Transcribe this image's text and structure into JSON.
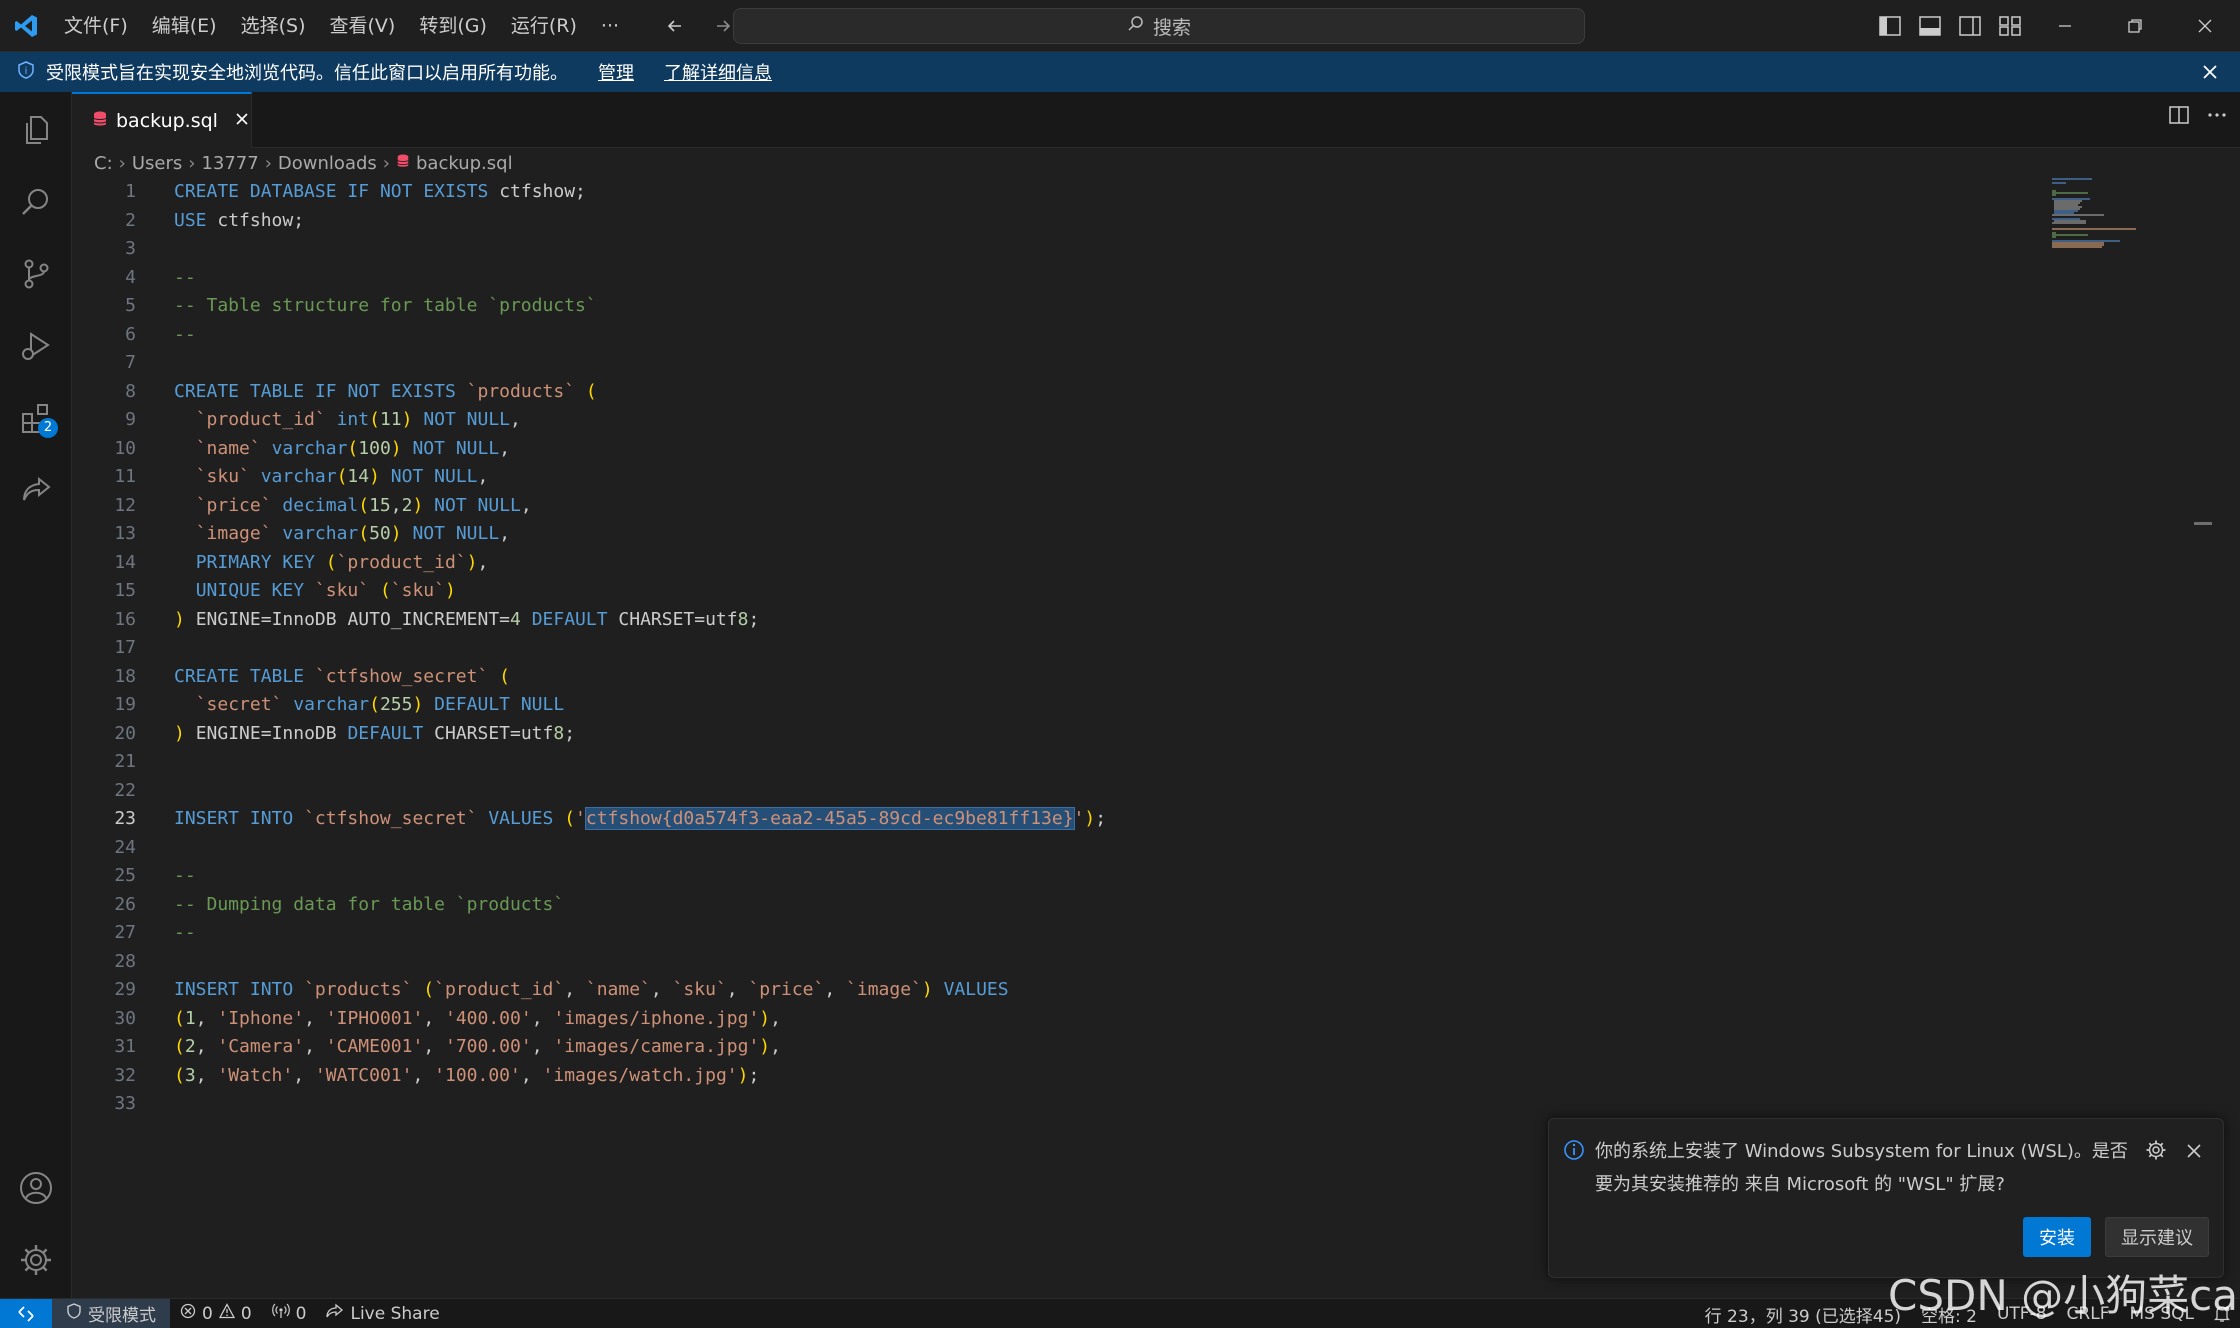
{
  "titlebar": {
    "menu": [
      "文件(F)",
      "编辑(E)",
      "选择(S)",
      "查看(V)",
      "转到(G)",
      "运行(R)",
      "···"
    ],
    "search_label": "搜索"
  },
  "banner": {
    "text": "受限模式旨在实现安全地浏览代码。信任此窗口以启用所有功能。",
    "manage": "管理",
    "learn_more": "了解详细信息"
  },
  "activity": {
    "extensions_badge": "2"
  },
  "tab": {
    "filename": "backup.sql"
  },
  "breadcrumb": [
    "C:",
    "Users",
    "13777",
    "Downloads",
    "backup.sql"
  ],
  "editor": {
    "active_line": 23,
    "lines": [
      "CREATE DATABASE IF NOT EXISTS ctfshow;",
      "USE ctfshow;",
      "",
      "--",
      "-- Table structure for table `products`",
      "--",
      "",
      "CREATE TABLE IF NOT EXISTS `products` (",
      "  `product_id` int(11) NOT NULL,",
      "  `name` varchar(100) NOT NULL,",
      "  `sku` varchar(14) NOT NULL,",
      "  `price` decimal(15,2) NOT NULL,",
      "  `image` varchar(50) NOT NULL,",
      "  PRIMARY KEY (`product_id`),",
      "  UNIQUE KEY `sku` (`sku`)",
      ") ENGINE=InnoDB AUTO_INCREMENT=4 DEFAULT CHARSET=utf8;",
      "",
      "CREATE TABLE `ctfshow_secret` (",
      "  `secret` varchar(255) DEFAULT NULL",
      ") ENGINE=InnoDB DEFAULT CHARSET=utf8;",
      "",
      "",
      "INSERT INTO `ctfshow_secret` VALUES ('ctfshow{d0a574f3-eaa2-45a5-89cd-ec9be81ff13e}');",
      "",
      "--",
      "-- Dumping data for table `products`",
      "--",
      "",
      "INSERT INTO `products` (`product_id`, `name`, `sku`, `price`, `image`) VALUES",
      "(1, 'Iphone', 'IPHO001', '400.00', 'images/iphone.jpg'),",
      "(2, 'Camera', 'CAME001', '700.00', 'images/camera.jpg'),",
      "(3, 'Watch', 'WATC001', '100.00', 'images/watch.jpg');",
      ""
    ]
  },
  "notification": {
    "message": "你的系统上安装了 Windows Subsystem for Linux (WSL)。是否要为其安装推荐的 来自 Microsoft 的 \"WSL\" 扩展?",
    "install": "安装",
    "show_recommendations": "显示建议"
  },
  "statusbar": {
    "restricted": "受限模式",
    "errors": "0",
    "warnings": "0",
    "ports": "0",
    "live_share": "Live Share",
    "position": "行 23，列 39 (已选择45)",
    "spaces": "空格: 2",
    "encoding": "UTF-8",
    "eol": "CRLF",
    "language": "MS SQL"
  },
  "watermark": "CSDN @小狗菜cai",
  "colors": {
    "accent": "#0078d4",
    "banner": "#0f3a5f",
    "keyword": "#569cd6",
    "comment": "#6a9955",
    "string": "#ce9178",
    "number": "#b5cea8",
    "selection": "#264f78"
  }
}
